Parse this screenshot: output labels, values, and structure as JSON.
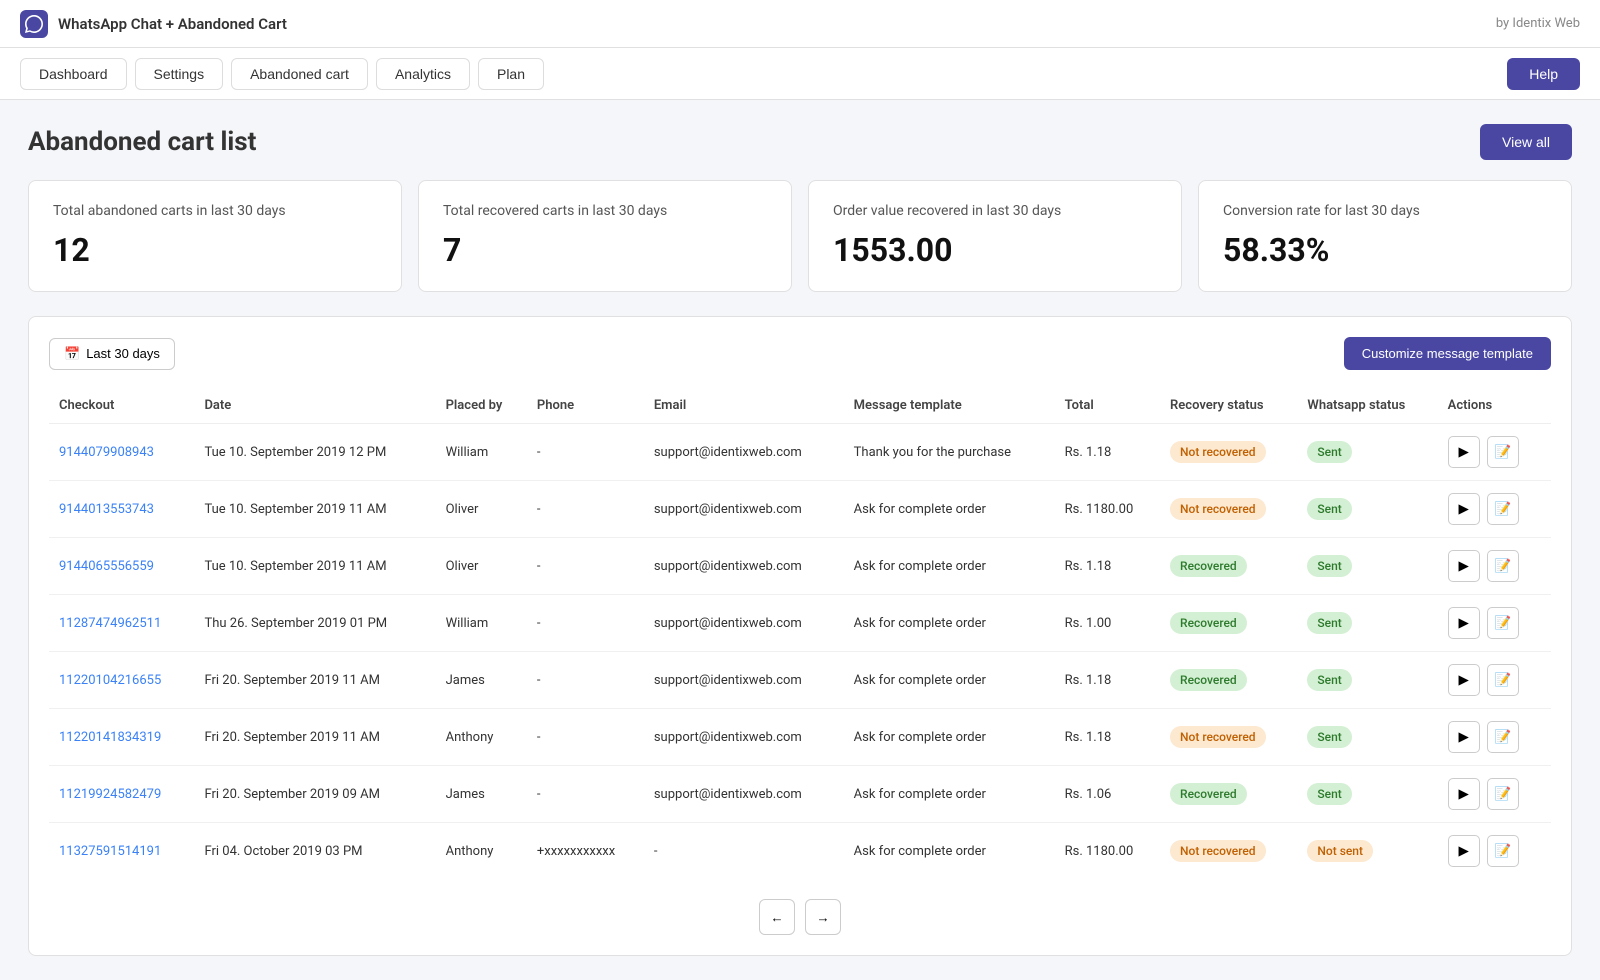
{
  "app": {
    "title": "WhatsApp Chat + Abandoned Cart",
    "by": "by Identix Web"
  },
  "nav": {
    "items": [
      "Dashboard",
      "Settings",
      "Abandoned cart",
      "Analytics",
      "Plan"
    ],
    "help_label": "Help"
  },
  "page": {
    "title": "Abandoned cart list",
    "view_all_label": "View all"
  },
  "stats": [
    {
      "label": "Total abandoned carts in last 30 days",
      "value": "12"
    },
    {
      "label": "Total recovered carts in last 30 days",
      "value": "7"
    },
    {
      "label": "Order value recovered in last 30 days",
      "value": "1553.00"
    },
    {
      "label": "Conversion rate for last 30 days",
      "value": "58.33%"
    }
  ],
  "table_toolbar": {
    "date_filter_label": "Last 30 days",
    "customize_btn_label": "Customize message template"
  },
  "table": {
    "columns": [
      "Checkout",
      "Date",
      "Placed by",
      "Phone",
      "Email",
      "Message template",
      "Total",
      "Recovery status",
      "Whatsapp status",
      "Actions"
    ],
    "rows": [
      {
        "checkout": "9144079908943",
        "date": "Tue 10. September 2019 12 PM",
        "placed_by": "William",
        "phone": "-",
        "email": "support@identixweb.com",
        "message_template": "Thank you for the purchase",
        "total": "Rs. 1.18",
        "recovery_status": "Not recovered",
        "recovery_status_type": "not-recovered",
        "whatsapp_status": "Sent",
        "whatsapp_status_type": "sent"
      },
      {
        "checkout": "9144013553743",
        "date": "Tue 10. September 2019 11 AM",
        "placed_by": "Oliver",
        "phone": "-",
        "email": "support@identixweb.com",
        "message_template": "Ask for complete order",
        "total": "Rs. 1180.00",
        "recovery_status": "Not recovered",
        "recovery_status_type": "not-recovered",
        "whatsapp_status": "Sent",
        "whatsapp_status_type": "sent"
      },
      {
        "checkout": "9144065556559",
        "date": "Tue 10. September 2019 11 AM",
        "placed_by": "Oliver",
        "phone": "-",
        "email": "support@identixweb.com",
        "message_template": "Ask for complete order",
        "total": "Rs. 1.18",
        "recovery_status": "Recovered",
        "recovery_status_type": "recovered",
        "whatsapp_status": "Sent",
        "whatsapp_status_type": "sent"
      },
      {
        "checkout": "11287474962511",
        "date": "Thu 26. September 2019 01 PM",
        "placed_by": "William",
        "phone": "-",
        "email": "support@identixweb.com",
        "message_template": "Ask for complete order",
        "total": "Rs. 1.00",
        "recovery_status": "Recovered",
        "recovery_status_type": "recovered",
        "whatsapp_status": "Sent",
        "whatsapp_status_type": "sent"
      },
      {
        "checkout": "11220104216655",
        "date": "Fri 20. September 2019 11 AM",
        "placed_by": "James",
        "phone": "-",
        "email": "support@identixweb.com",
        "message_template": "Ask for complete order",
        "total": "Rs. 1.18",
        "recovery_status": "Recovered",
        "recovery_status_type": "recovered",
        "whatsapp_status": "Sent",
        "whatsapp_status_type": "sent"
      },
      {
        "checkout": "11220141834319",
        "date": "Fri 20. September 2019 11 AM",
        "placed_by": "Anthony",
        "phone": "-",
        "email": "support@identixweb.com",
        "message_template": "Ask for complete order",
        "total": "Rs. 1.18",
        "recovery_status": "Not recovered",
        "recovery_status_type": "not-recovered",
        "whatsapp_status": "Sent",
        "whatsapp_status_type": "sent"
      },
      {
        "checkout": "11219924582479",
        "date": "Fri 20. September 2019 09 AM",
        "placed_by": "James",
        "phone": "-",
        "email": "support@identixweb.com",
        "message_template": "Ask for complete order",
        "total": "Rs. 1.06",
        "recovery_status": "Recovered",
        "recovery_status_type": "recovered",
        "whatsapp_status": "Sent",
        "whatsapp_status_type": "sent"
      },
      {
        "checkout": "11327591514191",
        "date": "Fri 04. October 2019 03 PM",
        "placed_by": "Anthony",
        "phone": "+xxxxxxxxxxx",
        "email": "-",
        "message_template": "Ask for complete order",
        "total": "Rs. 1180.00",
        "recovery_status": "Not recovered",
        "recovery_status_type": "not-recovered",
        "whatsapp_status": "Not sent",
        "whatsapp_status_type": "not-sent"
      }
    ]
  },
  "pagination": {
    "prev_label": "←",
    "next_label": "→"
  },
  "icons": {
    "calendar": "📅",
    "send": "▶",
    "edit": "✏"
  }
}
